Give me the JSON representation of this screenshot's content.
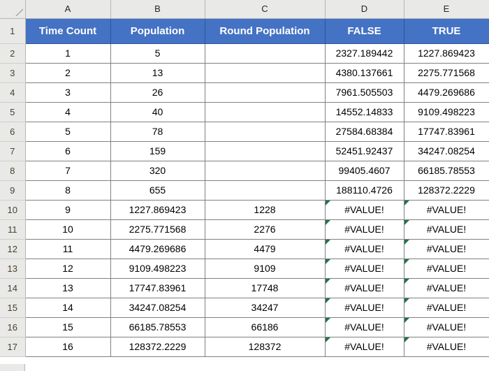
{
  "app": {
    "type": "spreadsheet",
    "corner_icon": "select-all-triangle-icon"
  },
  "colors": {
    "header_fill": "#4472C4",
    "header_text": "#FFFFFF",
    "grid_line": "#808080",
    "row_header_fill": "#E9E9E7",
    "error_marker": "#217346"
  },
  "column_letters": [
    "A",
    "B",
    "C",
    "D",
    "E"
  ],
  "row_numbers": [
    "1",
    "2",
    "3",
    "4",
    "5",
    "6",
    "7",
    "8",
    "9",
    "10",
    "11",
    "12",
    "13",
    "14",
    "15",
    "16",
    "17"
  ],
  "table": {
    "headers": [
      "Time Count",
      "Population",
      "Round Population",
      "FALSE",
      "TRUE"
    ],
    "rows": [
      {
        "a": "1",
        "b": "5",
        "c": "",
        "d": "2327.189442",
        "e": "1227.869423",
        "d_error": false,
        "e_error": false
      },
      {
        "a": "2",
        "b": "13",
        "c": "",
        "d": "4380.137661",
        "e": "2275.771568",
        "d_error": false,
        "e_error": false
      },
      {
        "a": "3",
        "b": "26",
        "c": "",
        "d": "7961.505503",
        "e": "4479.269686",
        "d_error": false,
        "e_error": false
      },
      {
        "a": "4",
        "b": "40",
        "c": "",
        "d": "14552.14833",
        "e": "9109.498223",
        "d_error": false,
        "e_error": false
      },
      {
        "a": "5",
        "b": "78",
        "c": "",
        "d": "27584.68384",
        "e": "17747.83961",
        "d_error": false,
        "e_error": false
      },
      {
        "a": "6",
        "b": "159",
        "c": "",
        "d": "52451.92437",
        "e": "34247.08254",
        "d_error": false,
        "e_error": false
      },
      {
        "a": "7",
        "b": "320",
        "c": "",
        "d": "99405.4607",
        "e": "66185.78553",
        "d_error": false,
        "e_error": false
      },
      {
        "a": "8",
        "b": "655",
        "c": "",
        "d": "188110.4726",
        "e": "128372.2229",
        "d_error": false,
        "e_error": false
      },
      {
        "a": "9",
        "b": "1227.869423",
        "c": "1228",
        "d": "#VALUE!",
        "e": "#VALUE!",
        "d_error": true,
        "e_error": true
      },
      {
        "a": "10",
        "b": "2275.771568",
        "c": "2276",
        "d": "#VALUE!",
        "e": "#VALUE!",
        "d_error": true,
        "e_error": true
      },
      {
        "a": "11",
        "b": "4479.269686",
        "c": "4479",
        "d": "#VALUE!",
        "e": "#VALUE!",
        "d_error": true,
        "e_error": true
      },
      {
        "a": "12",
        "b": "9109.498223",
        "c": "9109",
        "d": "#VALUE!",
        "e": "#VALUE!",
        "d_error": true,
        "e_error": true
      },
      {
        "a": "13",
        "b": "17747.83961",
        "c": "17748",
        "d": "#VALUE!",
        "e": "#VALUE!",
        "d_error": true,
        "e_error": true
      },
      {
        "a": "14",
        "b": "34247.08254",
        "c": "34247",
        "d": "#VALUE!",
        "e": "#VALUE!",
        "d_error": true,
        "e_error": true
      },
      {
        "a": "15",
        "b": "66185.78553",
        "c": "66186",
        "d": "#VALUE!",
        "e": "#VALUE!",
        "d_error": true,
        "e_error": true
      },
      {
        "a": "16",
        "b": "128372.2229",
        "c": "128372",
        "d": "#VALUE!",
        "e": "#VALUE!",
        "d_error": true,
        "e_error": true
      }
    ]
  }
}
